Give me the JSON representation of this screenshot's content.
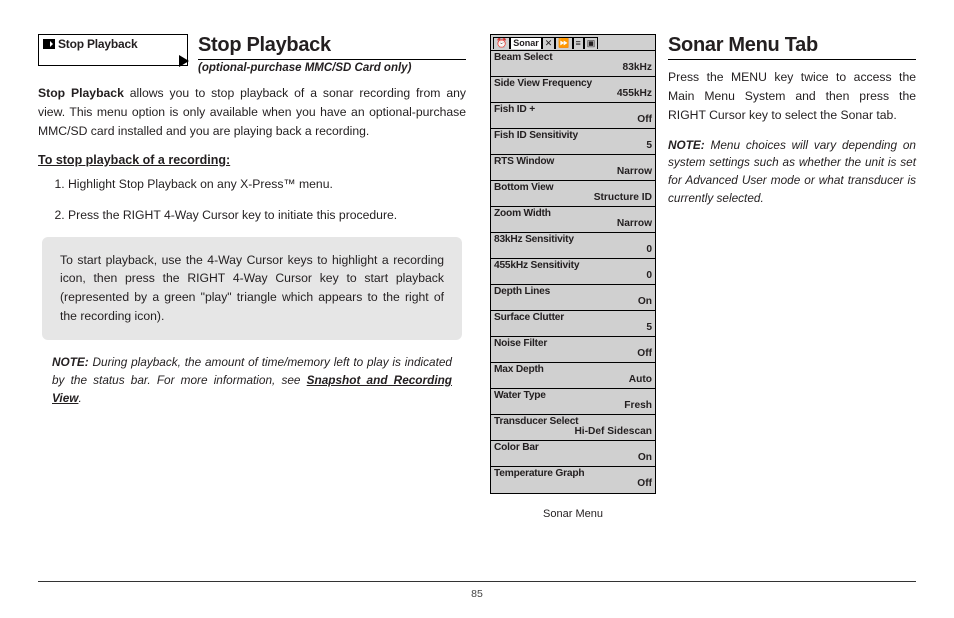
{
  "left": {
    "menu_box_label": "Stop Playback",
    "heading": "Stop Playback",
    "subtitle": "(optional-purchase MMC/SD Card only)",
    "para_lead": "Stop Playback",
    "para_body": " allows you to stop playback of a sonar recording from any view. This menu option is only available when you have an optional-purchase MMC/SD card installed and you are playing back a recording.",
    "subhead": "To stop playback of a recording:",
    "steps": [
      "Highlight Stop Playback on any X-Press™ menu.",
      "Press the RIGHT 4-Way Cursor key to initiate this procedure."
    ],
    "callout": "To start playback, use the 4-Way Cursor keys to highlight a recording icon, then press the RIGHT 4-Way Cursor key to start playback (represented by a green \"play\" triangle which appears to the right of the recording icon).",
    "note_label": "NOTE:",
    "note_body": "  During playback, the amount of time/memory left to play is indicated by the status bar. For more information, see ",
    "note_ref": "Snapshot and Recording View",
    "note_end": "."
  },
  "sonar_menu": {
    "tabs": [
      "⏰",
      "Sonar",
      "✕",
      "⏩",
      "≡",
      "▣"
    ],
    "active_tab": "Sonar",
    "rows": [
      {
        "label": "Beam Select",
        "value": "83kHz"
      },
      {
        "label": "Side View Frequency",
        "value": "455kHz"
      },
      {
        "label": "Fish ID +",
        "value": "Off"
      },
      {
        "label": "Fish ID Sensitivity",
        "value": "5"
      },
      {
        "label": "RTS Window",
        "value": "Narrow"
      },
      {
        "label": "Bottom View",
        "value": "Structure ID"
      },
      {
        "label": "Zoom Width",
        "value": "Narrow"
      },
      {
        "label": "83kHz Sensitivity",
        "value": "0"
      },
      {
        "label": "455kHz Sensitivity",
        "value": "0"
      },
      {
        "label": "Depth Lines",
        "value": "On"
      },
      {
        "label": "Surface Clutter",
        "value": "5"
      },
      {
        "label": "Noise Filter",
        "value": "Off"
      },
      {
        "label": "Max Depth",
        "value": "Auto"
      },
      {
        "label": "Water Type",
        "value": "Fresh"
      },
      {
        "label": "Transducer Select",
        "value": "Hi-Def Sidescan"
      },
      {
        "label": "Color Bar",
        "value": "On"
      },
      {
        "label": "Temperature Graph",
        "value": "Off"
      }
    ],
    "caption": "Sonar Menu"
  },
  "right": {
    "heading": "Sonar Menu Tab",
    "para": "Press the MENU key twice to access the Main Menu System and then press the RIGHT Cursor key to select the Sonar tab.",
    "note_label": "NOTE:",
    "note_body": " Menu choices will vary depending on system settings such as whether the unit is set for Advanced User mode or what transducer is currently selected."
  },
  "page_number": "85"
}
